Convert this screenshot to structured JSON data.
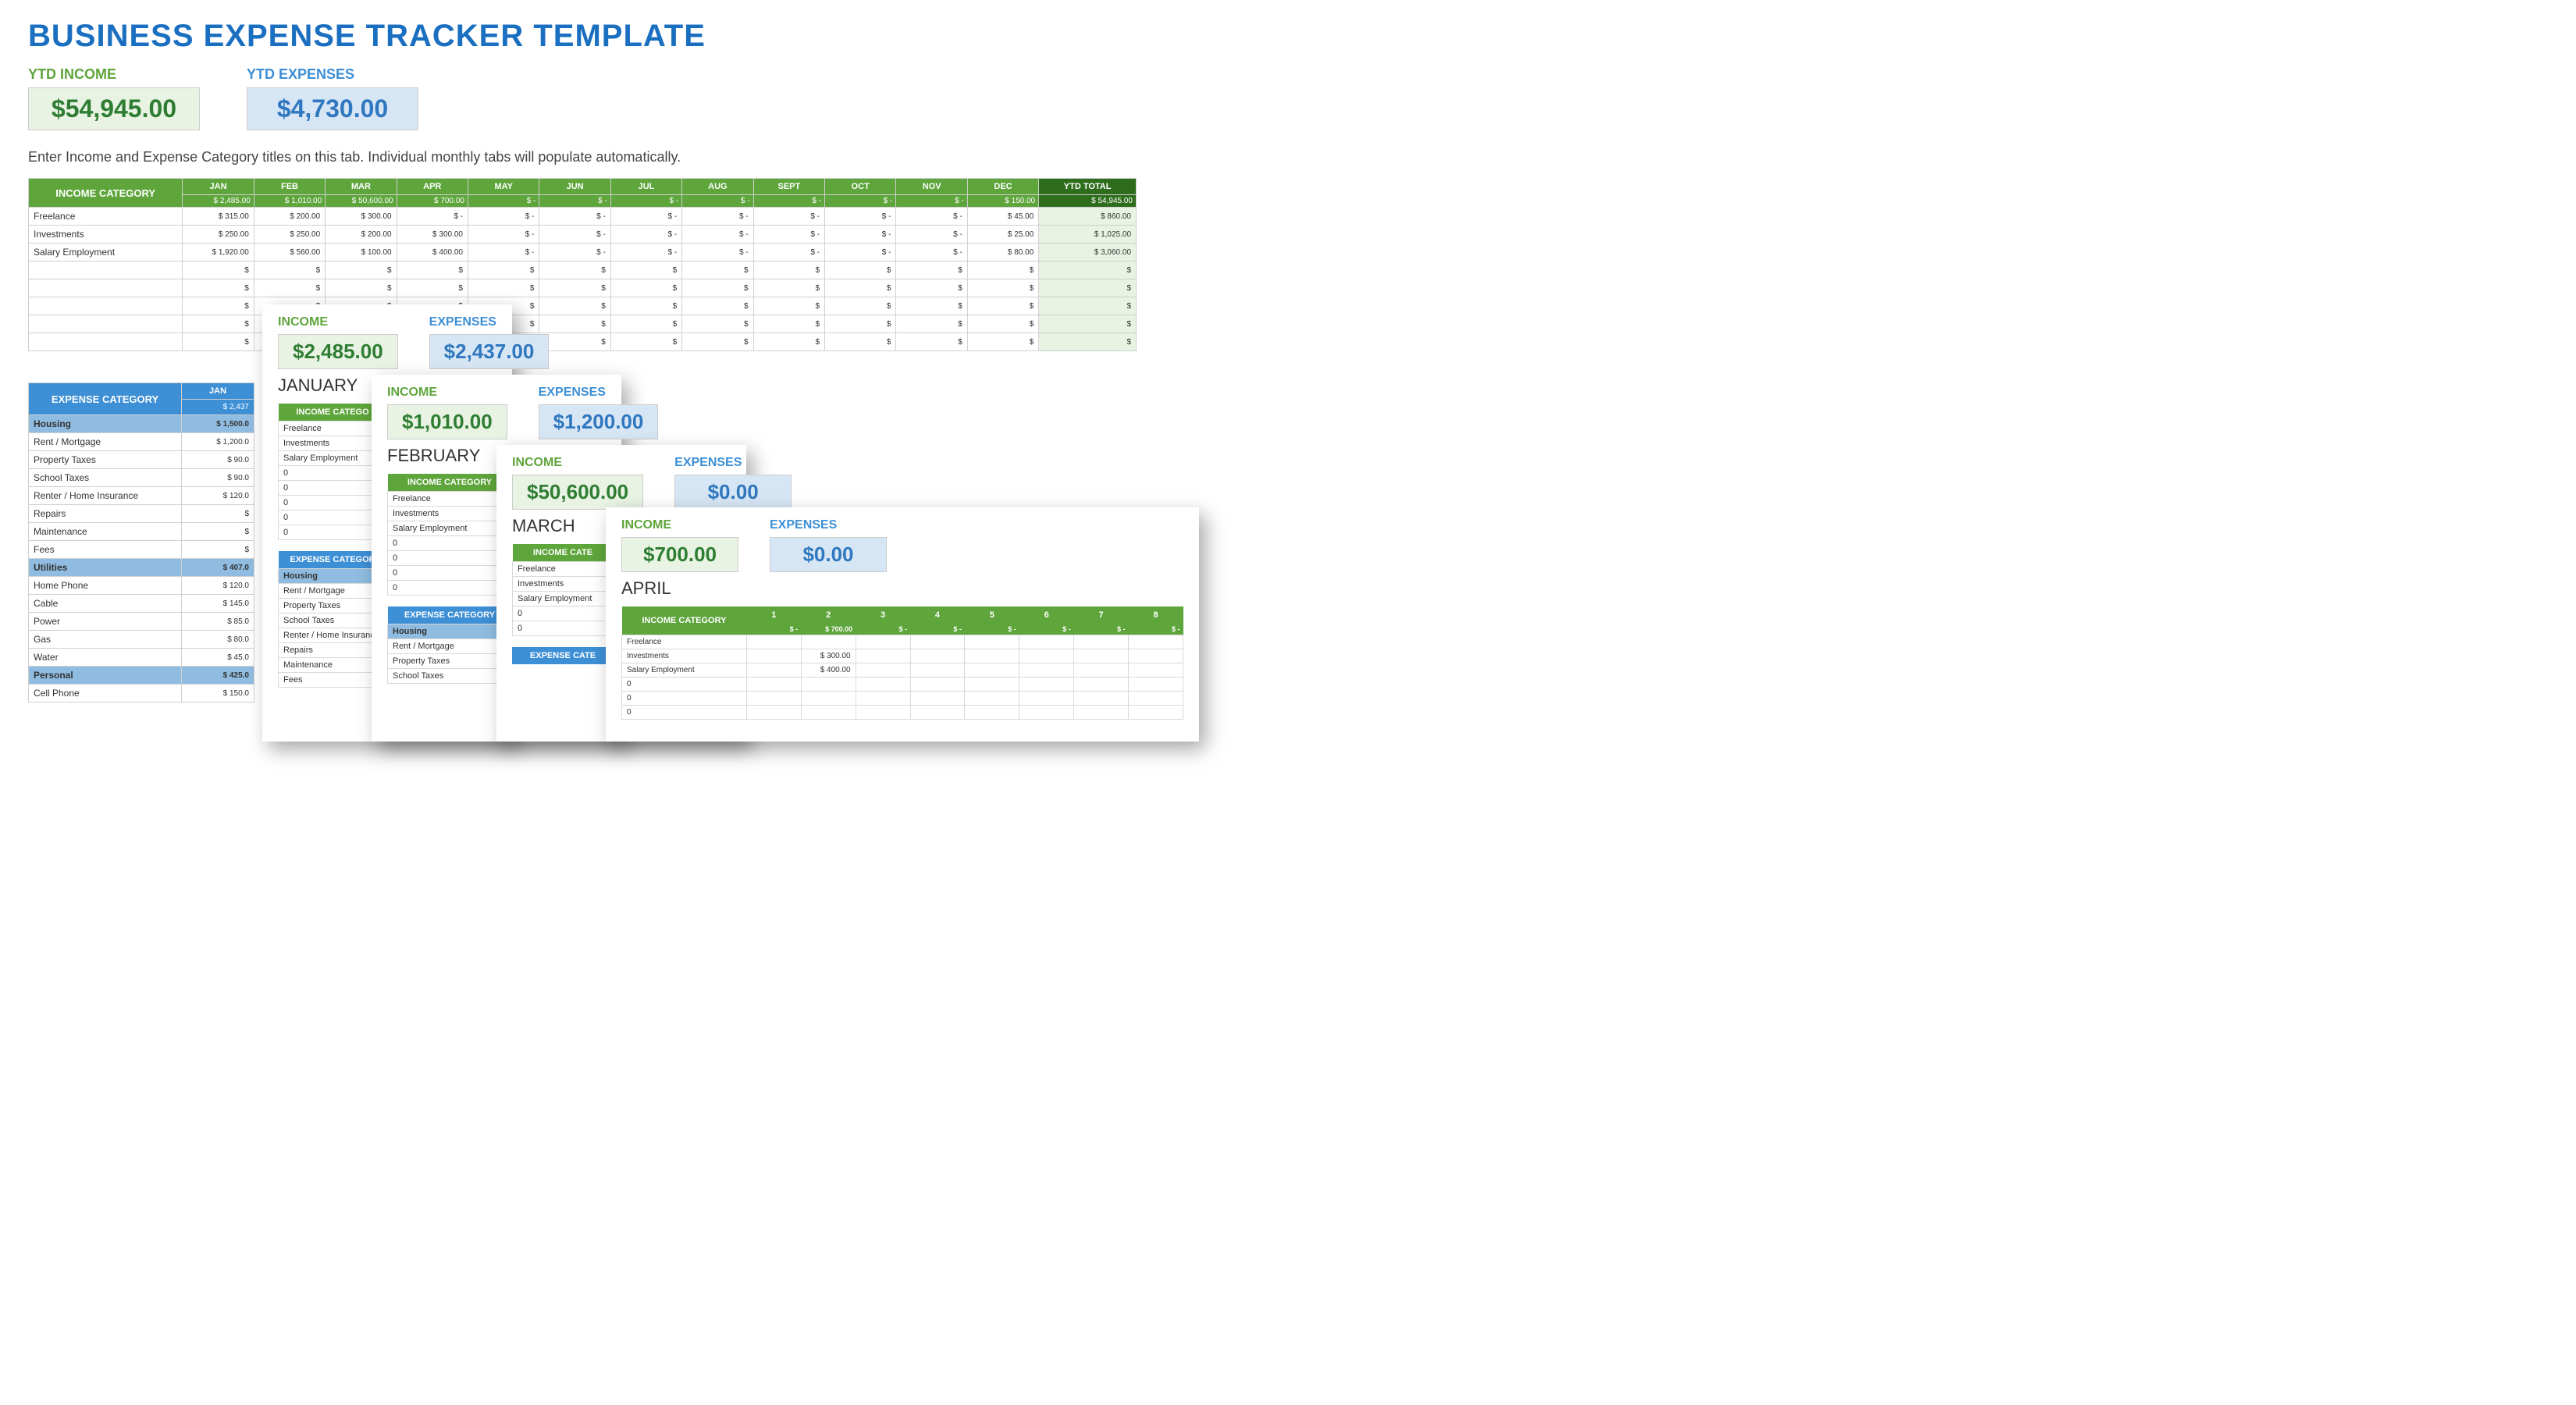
{
  "page": {
    "title": "BUSINESS EXPENSE TRACKER TEMPLATE",
    "instructions": "Enter Income and Expense Category titles on this tab.  Individual monthly tabs will populate automatically."
  },
  "ytd": {
    "income_label": "YTD INCOME",
    "income_value": "$54,945.00",
    "expenses_label": "YTD EXPENSES",
    "expenses_value": "$4,730.00"
  },
  "income_table": {
    "header": "INCOME CATEGORY",
    "ytd_header": "YTD TOTAL",
    "months": [
      "JAN",
      "FEB",
      "MAR",
      "APR",
      "MAY",
      "JUN",
      "JUL",
      "AUG",
      "SEPT",
      "OCT",
      "NOV",
      "DEC"
    ],
    "month_totals": [
      "2,485.00",
      "1,010.00",
      "50,600.00",
      "700.00",
      "-",
      "-",
      "-",
      "-",
      "-",
      "-",
      "-",
      "150.00"
    ],
    "ytd_total": "54,945.00",
    "rows": [
      {
        "name": "Freelance",
        "vals": [
          "315.00",
          "200.00",
          "300.00",
          "-",
          "-",
          "-",
          "-",
          "-",
          "-",
          "-",
          "-",
          "45.00"
        ],
        "ytd": "860.00"
      },
      {
        "name": "Investments",
        "vals": [
          "250.00",
          "250.00",
          "200.00",
          "300.00",
          "-",
          "-",
          "-",
          "-",
          "-",
          "-",
          "-",
          "25.00"
        ],
        "ytd": "1,025.00"
      },
      {
        "name": "Salary Employment",
        "vals": [
          "1,920.00",
          "560.00",
          "100.00",
          "400.00",
          "-",
          "-",
          "-",
          "-",
          "-",
          "-",
          "-",
          "80.00"
        ],
        "ytd": "3,060.00"
      }
    ],
    "empty_rows": 5,
    "cur": "$"
  },
  "expense_table": {
    "header": "EXPENSE CATEGORY",
    "month": "JAN",
    "month_total": "2,437",
    "cur": "$",
    "rows": [
      {
        "section": true,
        "name": "Housing",
        "val": "1,500.0"
      },
      {
        "section": false,
        "name": "Rent / Mortgage",
        "val": "1,200.0"
      },
      {
        "section": false,
        "name": "Property Taxes",
        "val": "90.0"
      },
      {
        "section": false,
        "name": "School Taxes",
        "val": "90.0"
      },
      {
        "section": false,
        "name": "Renter / Home Insurance",
        "val": "120.0"
      },
      {
        "section": false,
        "name": "Repairs",
        "val": ""
      },
      {
        "section": false,
        "name": "Maintenance",
        "val": ""
      },
      {
        "section": false,
        "name": "Fees",
        "val": ""
      },
      {
        "section": true,
        "name": "Utilities",
        "val": "407.0"
      },
      {
        "section": false,
        "name": "Home Phone",
        "val": "120.0"
      },
      {
        "section": false,
        "name": "Cable",
        "val": "145.0"
      },
      {
        "section": false,
        "name": "Power",
        "val": "85.0"
      },
      {
        "section": false,
        "name": "Gas",
        "val": "80.0"
      },
      {
        "section": false,
        "name": "Water",
        "val": "45.0"
      },
      {
        "section": true,
        "name": "Personal",
        "val": "425.0"
      },
      {
        "section": false,
        "name": "Cell Phone",
        "val": "150.0"
      }
    ]
  },
  "cards": {
    "january": {
      "income_label": "INCOME",
      "income_value": "$2,485.00",
      "expenses_label": "EXPENSES",
      "expenses_value": "$2,437.00",
      "month": "JANUARY",
      "income_header": "INCOME CATEGO",
      "income_rows": [
        "Freelance",
        "Investments",
        "Salary Employment",
        "0",
        "0",
        "0",
        "0",
        "0"
      ],
      "expense_header": "EXPENSE CATEGOR",
      "expense_rows": [
        {
          "section": true,
          "name": "Housing"
        },
        {
          "section": false,
          "name": "Rent / Mortgage"
        },
        {
          "section": false,
          "name": "Property Taxes"
        },
        {
          "section": false,
          "name": "School Taxes"
        },
        {
          "section": false,
          "name": "Renter / Home Insurance"
        },
        {
          "section": false,
          "name": "Repairs"
        },
        {
          "section": false,
          "name": "Maintenance"
        },
        {
          "section": false,
          "name": "Fees"
        }
      ]
    },
    "february": {
      "income_label": "INCOME",
      "income_value": "$1,010.00",
      "expenses_label": "EXPENSES",
      "expenses_value": "$1,200.00",
      "month": "FEBRUARY",
      "income_header": "INCOME CATEGORY",
      "income_rows": [
        "Freelance",
        "Investments",
        "Salary Employment",
        "0",
        "0",
        "0",
        "0"
      ],
      "expense_header": "EXPENSE CATEGORY",
      "expense_rows": [
        {
          "section": true,
          "name": "Housing"
        },
        {
          "section": false,
          "name": "Rent / Mortgage"
        },
        {
          "section": false,
          "name": "Property Taxes"
        },
        {
          "section": false,
          "name": "School Taxes"
        }
      ]
    },
    "march": {
      "income_label": "INCOME",
      "income_value": "$50,600.00",
      "expenses_label": "EXPENSES",
      "expenses_value": "$0.00",
      "month": "MARCH",
      "income_header": "INCOME CATE",
      "income_rows": [
        "Freelance",
        "Investments",
        "Salary Employment",
        "0",
        "0"
      ],
      "expense_header": "EXPENSE CATE"
    },
    "april": {
      "income_label": "INCOME",
      "income_value": "$700.00",
      "expenses_label": "EXPENSES",
      "expenses_value": "$0.00",
      "month": "APRIL",
      "income_header": "INCOME CATEGORY",
      "cols": [
        "1",
        "2",
        "3",
        "4",
        "5",
        "6",
        "7",
        "8"
      ],
      "sub_totals": [
        "-",
        "700.00",
        "-",
        "-",
        "-",
        "-",
        "-",
        "-"
      ],
      "rows": [
        {
          "name": "Freelance",
          "vals": [
            "",
            "",
            "",
            "",
            "",
            "",
            "",
            ""
          ]
        },
        {
          "name": "Investments",
          "vals": [
            "",
            "300.00",
            "",
            "",
            "",
            "",
            "",
            ""
          ]
        },
        {
          "name": "Salary Employment",
          "vals": [
            "",
            "400.00",
            "",
            "",
            "",
            "",
            "",
            ""
          ]
        },
        {
          "name": "0",
          "vals": [
            "",
            "",
            "",
            "",
            "",
            "",
            "",
            ""
          ]
        },
        {
          "name": "0",
          "vals": [
            "",
            "",
            "",
            "",
            "",
            "",
            "",
            ""
          ]
        },
        {
          "name": "0",
          "vals": [
            "",
            "",
            "",
            "",
            "",
            "",
            "",
            ""
          ]
        }
      ],
      "cur": "$"
    }
  }
}
